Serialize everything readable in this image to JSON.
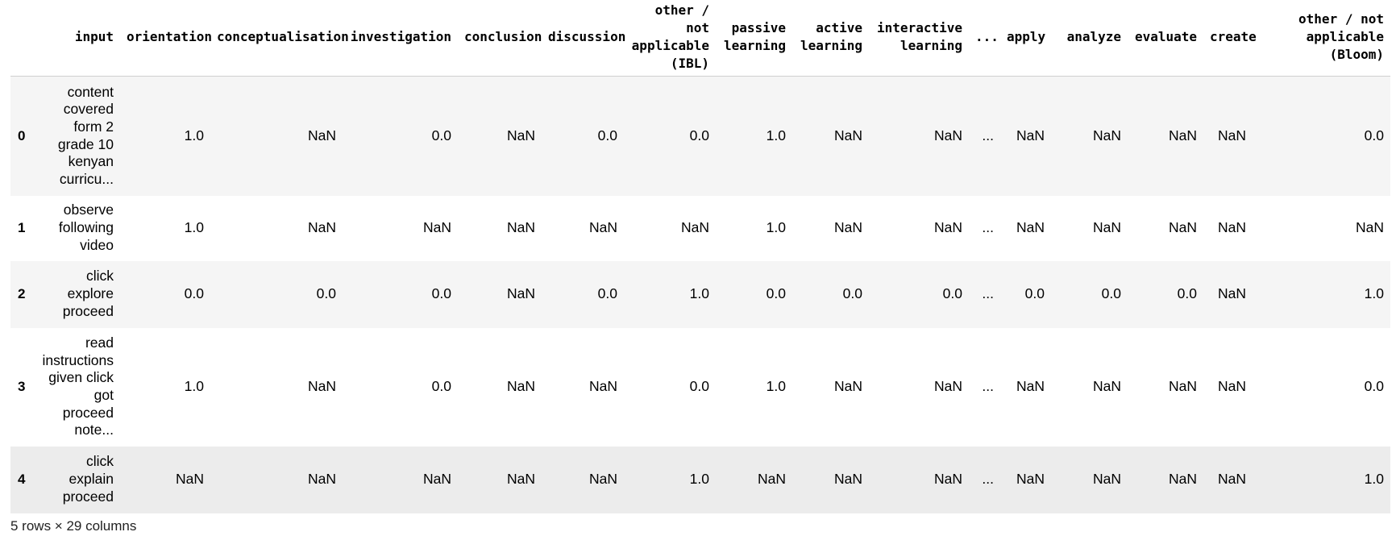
{
  "table": {
    "columns": [
      "",
      "input",
      "orientation",
      "conceptualisation",
      "investigation",
      "conclusion",
      "discussion",
      "other / not applicable (IBL)",
      "passive learning",
      "active learning",
      "interactive learning",
      "...",
      "apply",
      "analyze",
      "evaluate",
      "create",
      "other / not applicable (Bloom)"
    ],
    "rows": [
      {
        "index": "0",
        "cells": [
          "content covered form 2 grade 10 kenyan curricu...",
          "1.0",
          "NaN",
          "0.0",
          "NaN",
          "0.0",
          "0.0",
          "1.0",
          "NaN",
          "NaN",
          "...",
          "NaN",
          "NaN",
          "NaN",
          "NaN",
          "0.0"
        ]
      },
      {
        "index": "1",
        "cells": [
          "observe following video",
          "1.0",
          "NaN",
          "NaN",
          "NaN",
          "NaN",
          "NaN",
          "1.0",
          "NaN",
          "NaN",
          "...",
          "NaN",
          "NaN",
          "NaN",
          "NaN",
          "NaN"
        ]
      },
      {
        "index": "2",
        "cells": [
          "click explore proceed",
          "0.0",
          "0.0",
          "0.0",
          "NaN",
          "0.0",
          "1.0",
          "0.0",
          "0.0",
          "0.0",
          "...",
          "0.0",
          "0.0",
          "0.0",
          "NaN",
          "1.0"
        ]
      },
      {
        "index": "3",
        "cells": [
          "read instructions given click got proceed note...",
          "1.0",
          "NaN",
          "0.0",
          "NaN",
          "NaN",
          "0.0",
          "1.0",
          "NaN",
          "NaN",
          "...",
          "NaN",
          "NaN",
          "NaN",
          "NaN",
          "0.0"
        ]
      },
      {
        "index": "4",
        "cells": [
          "click explain proceed",
          "NaN",
          "NaN",
          "NaN",
          "NaN",
          "NaN",
          "1.0",
          "NaN",
          "NaN",
          "NaN",
          "...",
          "NaN",
          "NaN",
          "NaN",
          "NaN",
          "1.0"
        ]
      }
    ]
  },
  "footer": {
    "shape_text": "5 rows × 29 columns"
  }
}
